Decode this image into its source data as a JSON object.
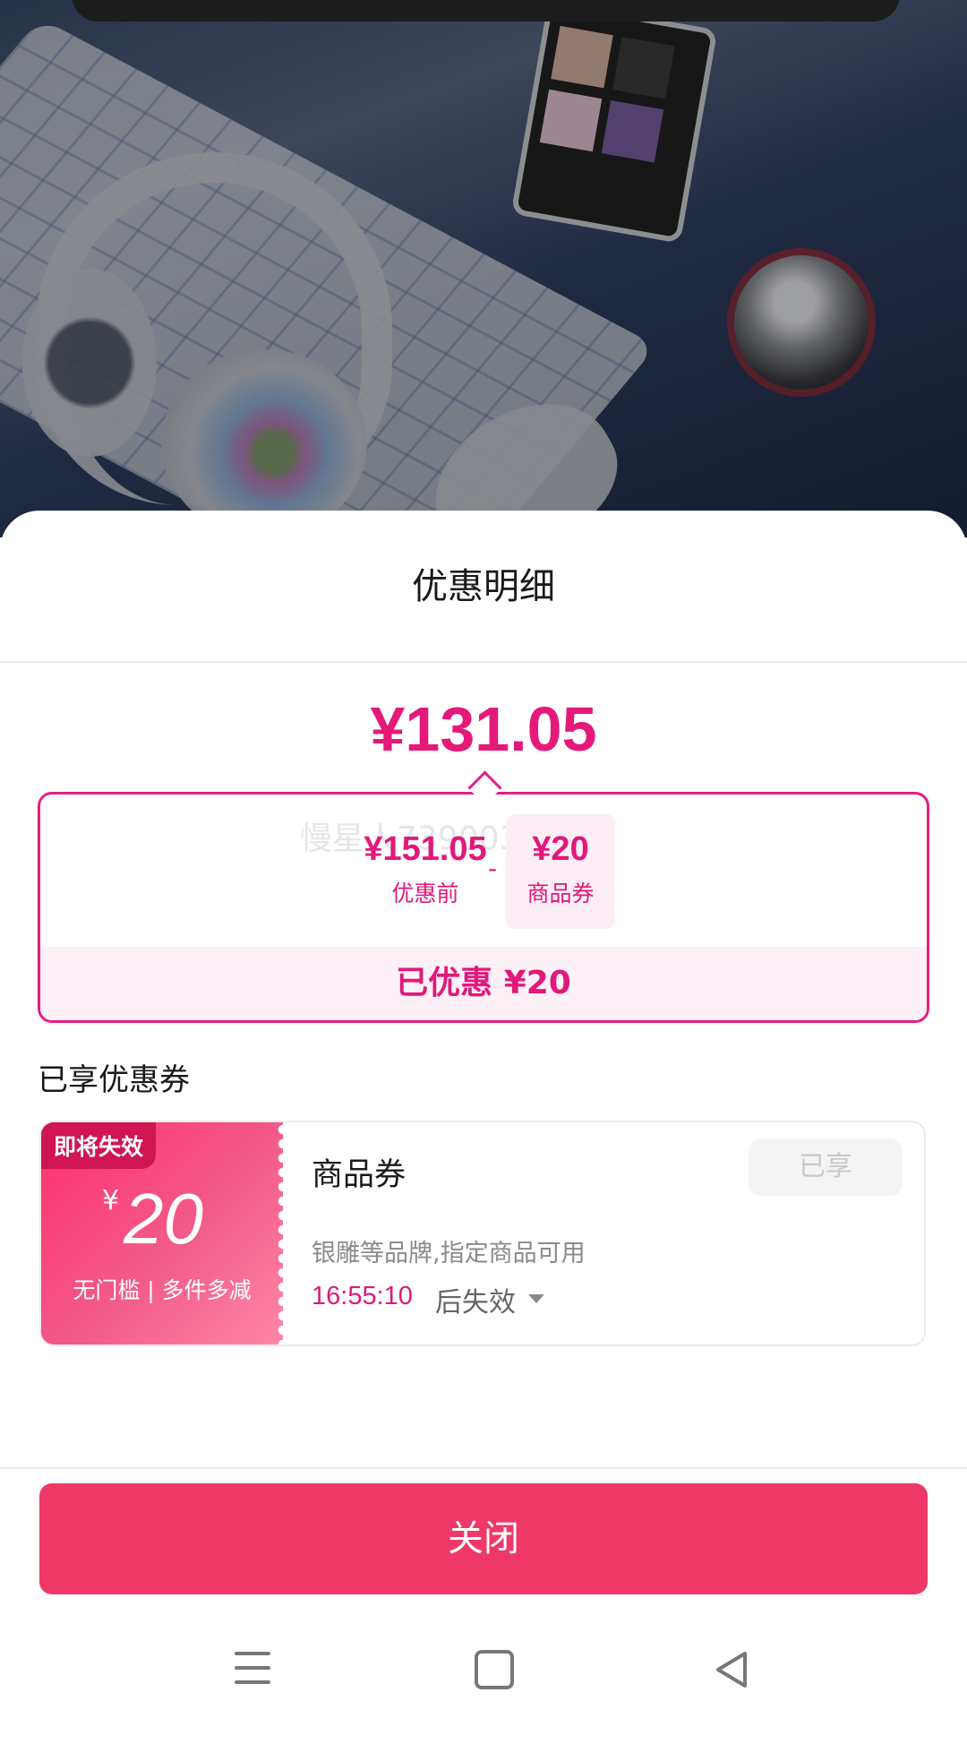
{
  "sheet": {
    "title": "优惠明细",
    "final_price": "¥131.05",
    "breakdown": {
      "watermark": "慢星人73900358R",
      "original_amount": "¥151.05",
      "original_label": "优惠前",
      "minus": "-",
      "coupon_amount": "¥20",
      "coupon_label": "商品券",
      "saved_text": "已优惠 ¥20"
    },
    "section_title": "已享优惠券",
    "coupon": {
      "badge": "即将失效",
      "currency": "¥",
      "value": "20",
      "condition": "无门槛 | 多件多减",
      "name": "商品券",
      "status": "已享",
      "description": "银雕等品牌,指定商品可用",
      "countdown": "16:55:10",
      "countdown_suffix": "后失效"
    },
    "close_label": "关闭"
  },
  "colors": {
    "accent": "#e5197a",
    "close_button": "#ef3768",
    "coupon_gradient_start": "#ff2f6f",
    "coupon_gradient_end": "#ff86a7"
  },
  "icons": {
    "nav": [
      "menu-icon",
      "home-icon",
      "back-icon"
    ],
    "dropdown": "chevron-down-icon"
  }
}
